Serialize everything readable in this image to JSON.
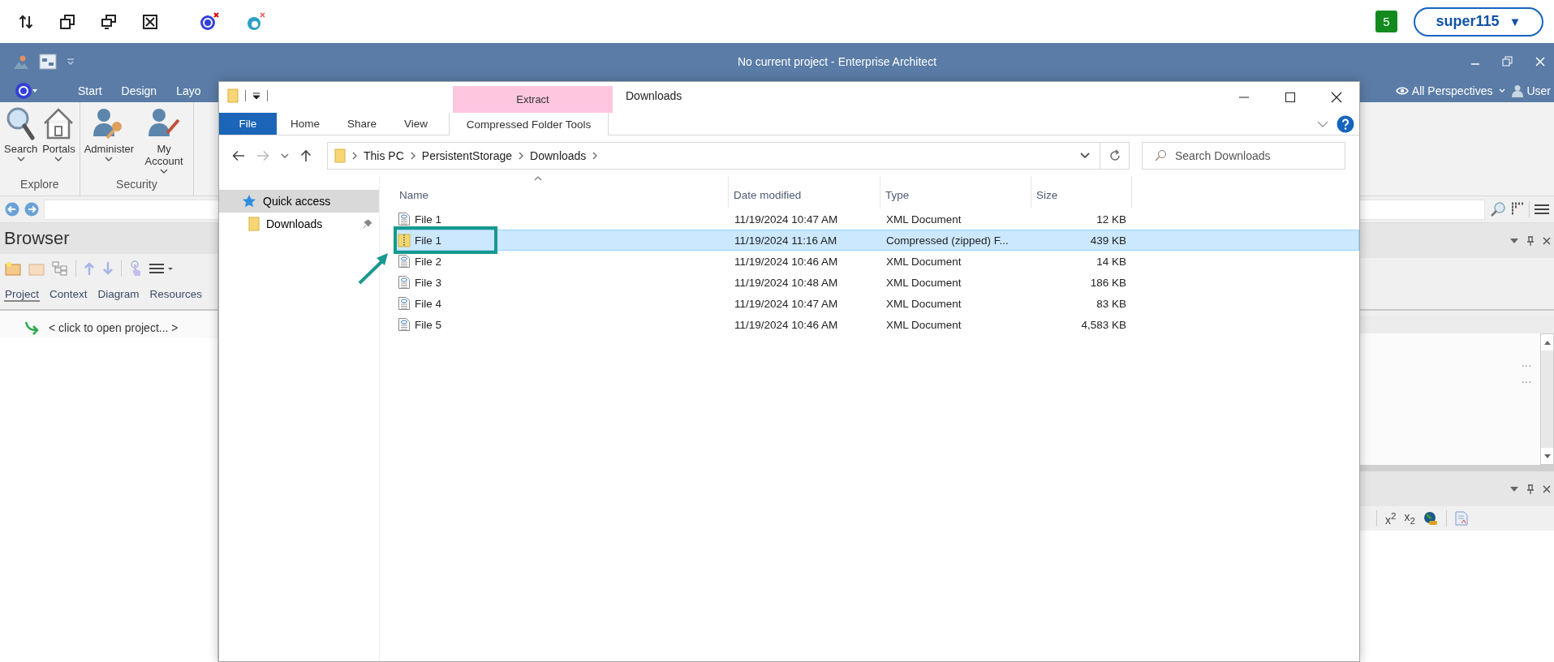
{
  "top_bar": {
    "badge": "5",
    "user_button": "super115",
    "user_caret": "▼"
  },
  "ea": {
    "title": "No current project - Enterprise Architect",
    "tabs": [
      "Start",
      "Design",
      "Layo"
    ],
    "perspectives": "All Perspectives",
    "user": "User",
    "ribbon_groups": [
      {
        "label": "Explore",
        "buttons": [
          {
            "label": "Search",
            "kind": "search"
          },
          {
            "label": "Portals",
            "kind": "portals"
          }
        ]
      },
      {
        "label": "Security",
        "buttons": [
          {
            "label": "Administer",
            "kind": "administer"
          },
          {
            "label": "My Account",
            "kind": "account"
          }
        ]
      }
    ],
    "browser": {
      "title": "Browser",
      "tabs": [
        {
          "label": "Project",
          "selected": true
        },
        {
          "label": "Context",
          "selected": false
        },
        {
          "label": "Diagram",
          "selected": false
        },
        {
          "label": "Resources",
          "selected": false
        }
      ],
      "open_hint": "< click to open project... >"
    },
    "right_panel": {
      "list_items": [
        "...",
        "..."
      ],
      "format_buttons": [
        "x$^{2}$",
        "x$_{2}$"
      ]
    }
  },
  "explorer": {
    "title": "Downloads",
    "context_group": "Extract",
    "tabs": [
      {
        "label": "File",
        "kind": "file"
      },
      {
        "label": "Home",
        "kind": "plain"
      },
      {
        "label": "Share",
        "kind": "plain"
      },
      {
        "label": "View",
        "kind": "plain"
      },
      {
        "label": "Compressed Folder Tools",
        "kind": "context"
      }
    ],
    "path": [
      "This PC",
      "PersistentStorage",
      "Downloads"
    ],
    "search": {
      "placeholder": "Search Downloads"
    },
    "nav": [
      {
        "label": "Quick access",
        "kind": "quick",
        "selected": true,
        "pinned": false
      },
      {
        "label": "Downloads",
        "kind": "folder",
        "selected": false,
        "pinned": true
      }
    ],
    "columns": [
      "Name",
      "Date modified",
      "Type",
      "Size"
    ],
    "rows": [
      {
        "name": "File 1",
        "date": "11/19/2024 10:47 AM",
        "type": "XML Document",
        "size": "12 KB",
        "kind": "xml",
        "selected": false,
        "callout": false
      },
      {
        "name": "File 1",
        "date": "11/19/2024 11:16 AM",
        "type": "Compressed (zipped) F...",
        "size": "439 KB",
        "kind": "zip",
        "selected": true,
        "callout": true
      },
      {
        "name": "File 2",
        "date": "11/19/2024 10:46 AM",
        "type": "XML Document",
        "size": "14 KB",
        "kind": "xml",
        "selected": false,
        "callout": false
      },
      {
        "name": "File 3",
        "date": "11/19/2024 10:48 AM",
        "type": "XML Document",
        "size": "186 KB",
        "kind": "xml",
        "selected": false,
        "callout": false
      },
      {
        "name": "File 4",
        "date": "11/19/2024 10:47 AM",
        "type": "XML Document",
        "size": "83 KB",
        "kind": "xml",
        "selected": false,
        "callout": false
      },
      {
        "name": "File 5",
        "date": "11/19/2024 10:46 AM",
        "type": "XML Document",
        "size": "4,583 KB",
        "kind": "xml",
        "selected": false,
        "callout": false
      }
    ]
  }
}
